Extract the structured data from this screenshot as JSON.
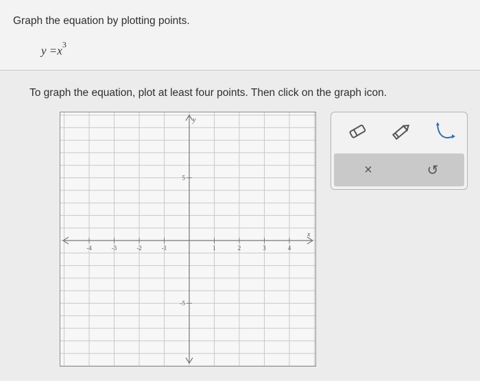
{
  "question": {
    "instruction": "Graph the equation by plotting points.",
    "equation_lhs": "y =",
    "equation_base": "x",
    "equation_exponent": "3"
  },
  "prompt": "To graph the equation, plot at least four points. Then click on the graph icon.",
  "graph": {
    "x_axis_label": "x",
    "y_axis_label": "y",
    "x_range": [
      -5,
      5
    ],
    "y_range": [
      -10,
      10
    ],
    "x_tick_labels": [
      "-4",
      "-3",
      "-2",
      "-1",
      "1",
      "2",
      "3",
      "4"
    ],
    "y_tick_labels": [
      "5",
      "-5"
    ]
  },
  "tools": {
    "eraser": "eraser-icon",
    "pencil": "pencil-icon",
    "graph": "curve-graph-icon",
    "clear_symbol": "×",
    "undo_symbol": "↺"
  }
}
